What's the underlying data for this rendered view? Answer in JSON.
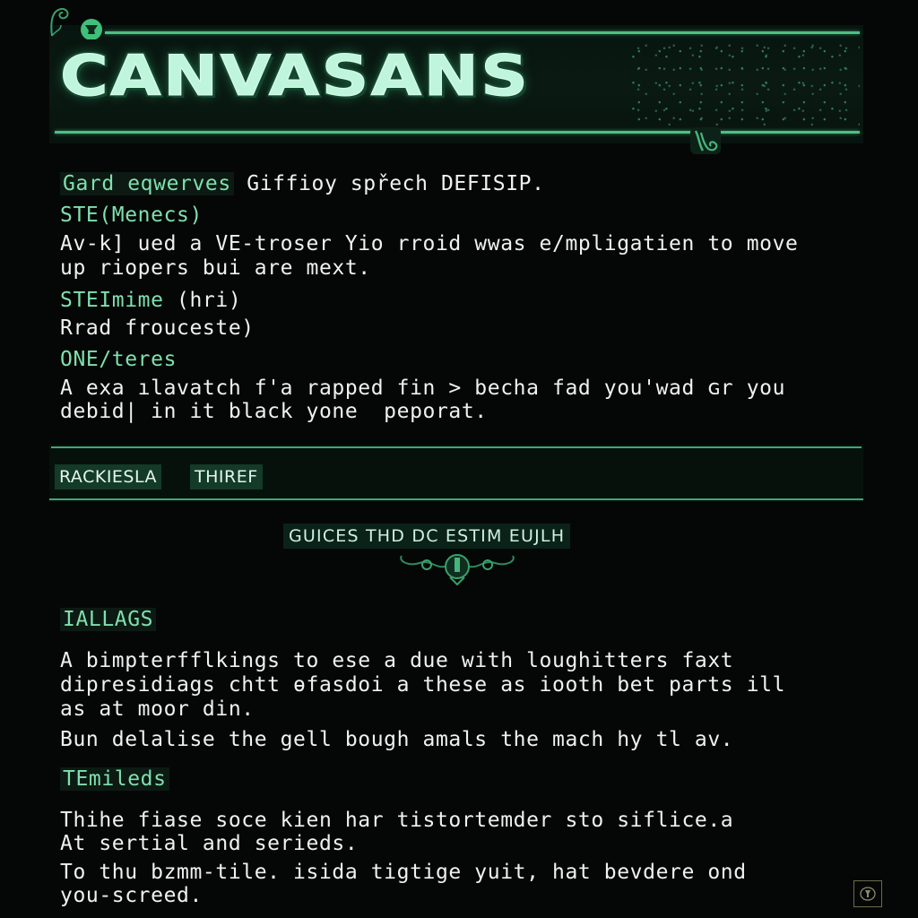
{
  "header": {
    "title": "CANVASANS"
  },
  "intro": {
    "label": "Gard eqwerves",
    "text": " Giffioy spřech DEFISIP."
  },
  "sections_top": [
    {
      "label": "STE(Menecs)",
      "lines": [
        "Av-k] ued a VE-troser Yio rroid wwas e/mpligatien to move",
        "up riopers bui are mext."
      ]
    },
    {
      "label": "STEImime",
      "label_suffix": " (hri)",
      "lines": [
        "Rrad frouceste)"
      ]
    },
    {
      "label": "ONE/teres",
      "lines": [
        "A exa ılavatch f'a rapped fin > becha fad you'wad ɢr you",
        "debid| in it black yone  peporat."
      ]
    }
  ],
  "section_bar": {
    "chips": [
      "RACKIESLA",
      "THIREF"
    ]
  },
  "subtitle": "GUICES THD DC ESTIM EUJLH",
  "sections_bottom": [
    {
      "label": "IALLAGS",
      "lines": [
        "A bimpterfflkings to ese a due with loughitters faxt",
        "dipresidiags chtt ɵfasdoi a these as iooth bet parts ill",
        "as at moor din.",
        "Bun delalise the gell bough amals the mach hy tl av."
      ]
    },
    {
      "label": "TEmileds",
      "lines": [
        "Thihe fiase soce kien har tistortemder sto siflice.a",
        "At sertial and serieds.",
        "To thu bzmm-tile. isida tigtige yuit, hat bevdere ond",
        "you-screed."
      ]
    }
  ],
  "icons": {
    "top_left": "shield-emblem-icon",
    "banner_corner": "swirl-ornament-icon",
    "crest": "crest-ornament-icon",
    "corner_badge": "emblem-badge-icon"
  },
  "colors": {
    "accent": "#4fbf86",
    "label": "#7fe0ae",
    "title": "#bff5dc",
    "background": "#050706"
  }
}
